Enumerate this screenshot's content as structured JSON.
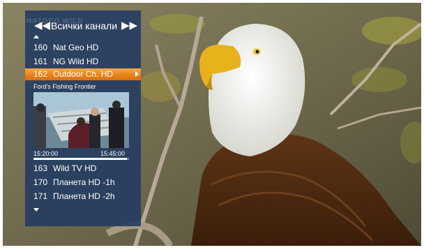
{
  "guide": {
    "title": "Всички канали",
    "channels_top": [
      {
        "number": "160",
        "name": "Nat Geo HD"
      },
      {
        "number": "161",
        "name": "NG Wild HD"
      }
    ],
    "selected": {
      "number": "162",
      "name": "Outdoor Ch. HD"
    },
    "program": {
      "title": "Ford's Fishing Frontier",
      "start": "15:20:00",
      "end": "15:45:00",
      "progress": 0.98
    },
    "channels_bottom": [
      {
        "number": "163",
        "name": "Wild TV HD"
      },
      {
        "number": "170",
        "name": "Планета HD -1h"
      },
      {
        "number": "171",
        "name": "Планета HD -2h"
      }
    ]
  },
  "icons": {
    "prev": "double-arrow-left-icon",
    "next": "double-arrow-right-icon",
    "scroll_up": "triangle-up-icon",
    "scroll_down": "triangle-down-icon"
  },
  "colors": {
    "panel": "#243c60",
    "highlight": "#e8821c"
  }
}
